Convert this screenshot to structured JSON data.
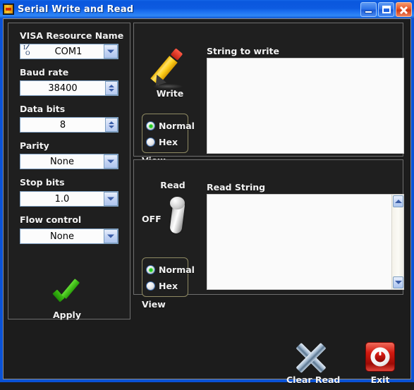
{
  "window": {
    "title": "Serial Write and Read",
    "icon": "labview-vi-icon",
    "buttons": {
      "minimize": "minimize-button",
      "maximize": "maximize-button",
      "close": "close-button"
    }
  },
  "serial_settings": {
    "visa": {
      "label": "VISA Resource Name",
      "value": "COM1",
      "glyph_top": "I",
      "glyph_bottom": "O"
    },
    "baud": {
      "label": "Baud rate",
      "value": "38400"
    },
    "data_bits": {
      "label": "Data bits",
      "value": "8"
    },
    "parity": {
      "label": "Parity",
      "value": "None"
    },
    "stop_bits": {
      "label": "Stop bits",
      "value": "1.0"
    },
    "flow_control": {
      "label": "Flow control",
      "value": "None"
    },
    "apply": {
      "label": "Apply",
      "icon": "green-check-icon"
    }
  },
  "write_section": {
    "button_label": "Write",
    "button_icon": "pencil-icon",
    "view_label": "View",
    "view_options": [
      {
        "label": "Normal",
        "selected": true
      },
      {
        "label": "Hex",
        "selected": false
      }
    ],
    "string_label": "String to write",
    "string_value": "",
    "string_placeholder": ""
  },
  "read_section": {
    "button_label": "Read",
    "switch_state": "OFF",
    "switch_icon": "toggle-switch-icon",
    "view_label": "View",
    "view_options": [
      {
        "label": "Normal",
        "selected": true
      },
      {
        "label": "Hex",
        "selected": false
      }
    ],
    "string_label": "Read String",
    "string_value": "",
    "string_placeholder": ""
  },
  "bottom_bar": {
    "clear_read": {
      "label": "Clear Read",
      "icon": "blue-x-icon"
    },
    "exit": {
      "label": "Exit",
      "icon": "red-power-icon"
    }
  },
  "colors": {
    "titlebar_blue": "#0a57dd",
    "panel_background": "#1f1f1f",
    "label_text": "#f2f2f2",
    "control_background": "#fcfcfc",
    "control_border": "#7d9ec0",
    "accent_green": "#22cc22",
    "exit_red": "#d21a10",
    "close_red": "#e4552a"
  }
}
